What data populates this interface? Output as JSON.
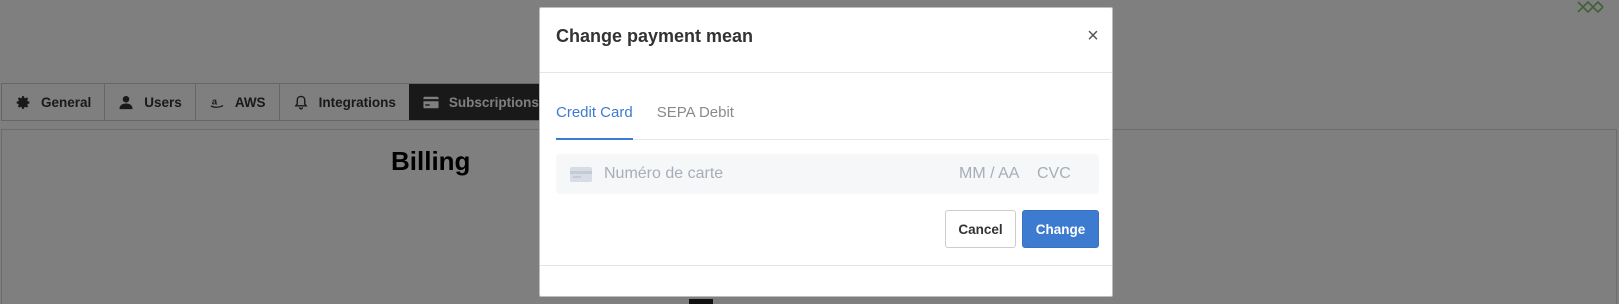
{
  "app": {
    "tabs": [
      {
        "label": "General",
        "icon": "gear-icon"
      },
      {
        "label": "Users",
        "icon": "user-icon"
      },
      {
        "label": "AWS",
        "icon": "amazon-icon"
      },
      {
        "label": "Integrations",
        "icon": "bell-icon"
      },
      {
        "label": "Subscriptions",
        "icon": "credit-card-icon",
        "active": true
      }
    ],
    "page_title": "Billing"
  },
  "modal": {
    "title": "Change payment mean",
    "close_symbol": "×",
    "tabs": [
      {
        "label": "Credit Card",
        "active": true
      },
      {
        "label": "SEPA Debit",
        "active": false
      }
    ],
    "card_form": {
      "number_placeholder": "Numéro de carte",
      "expiry_placeholder": "MM / AA",
      "cvc_placeholder": "CVC"
    },
    "buttons": {
      "cancel": "Cancel",
      "change": "Change"
    }
  },
  "colors": {
    "accent": "#3d7bd0",
    "active_tab_bg": "#333333",
    "backdrop": "rgba(0,0,0,0.5)"
  }
}
